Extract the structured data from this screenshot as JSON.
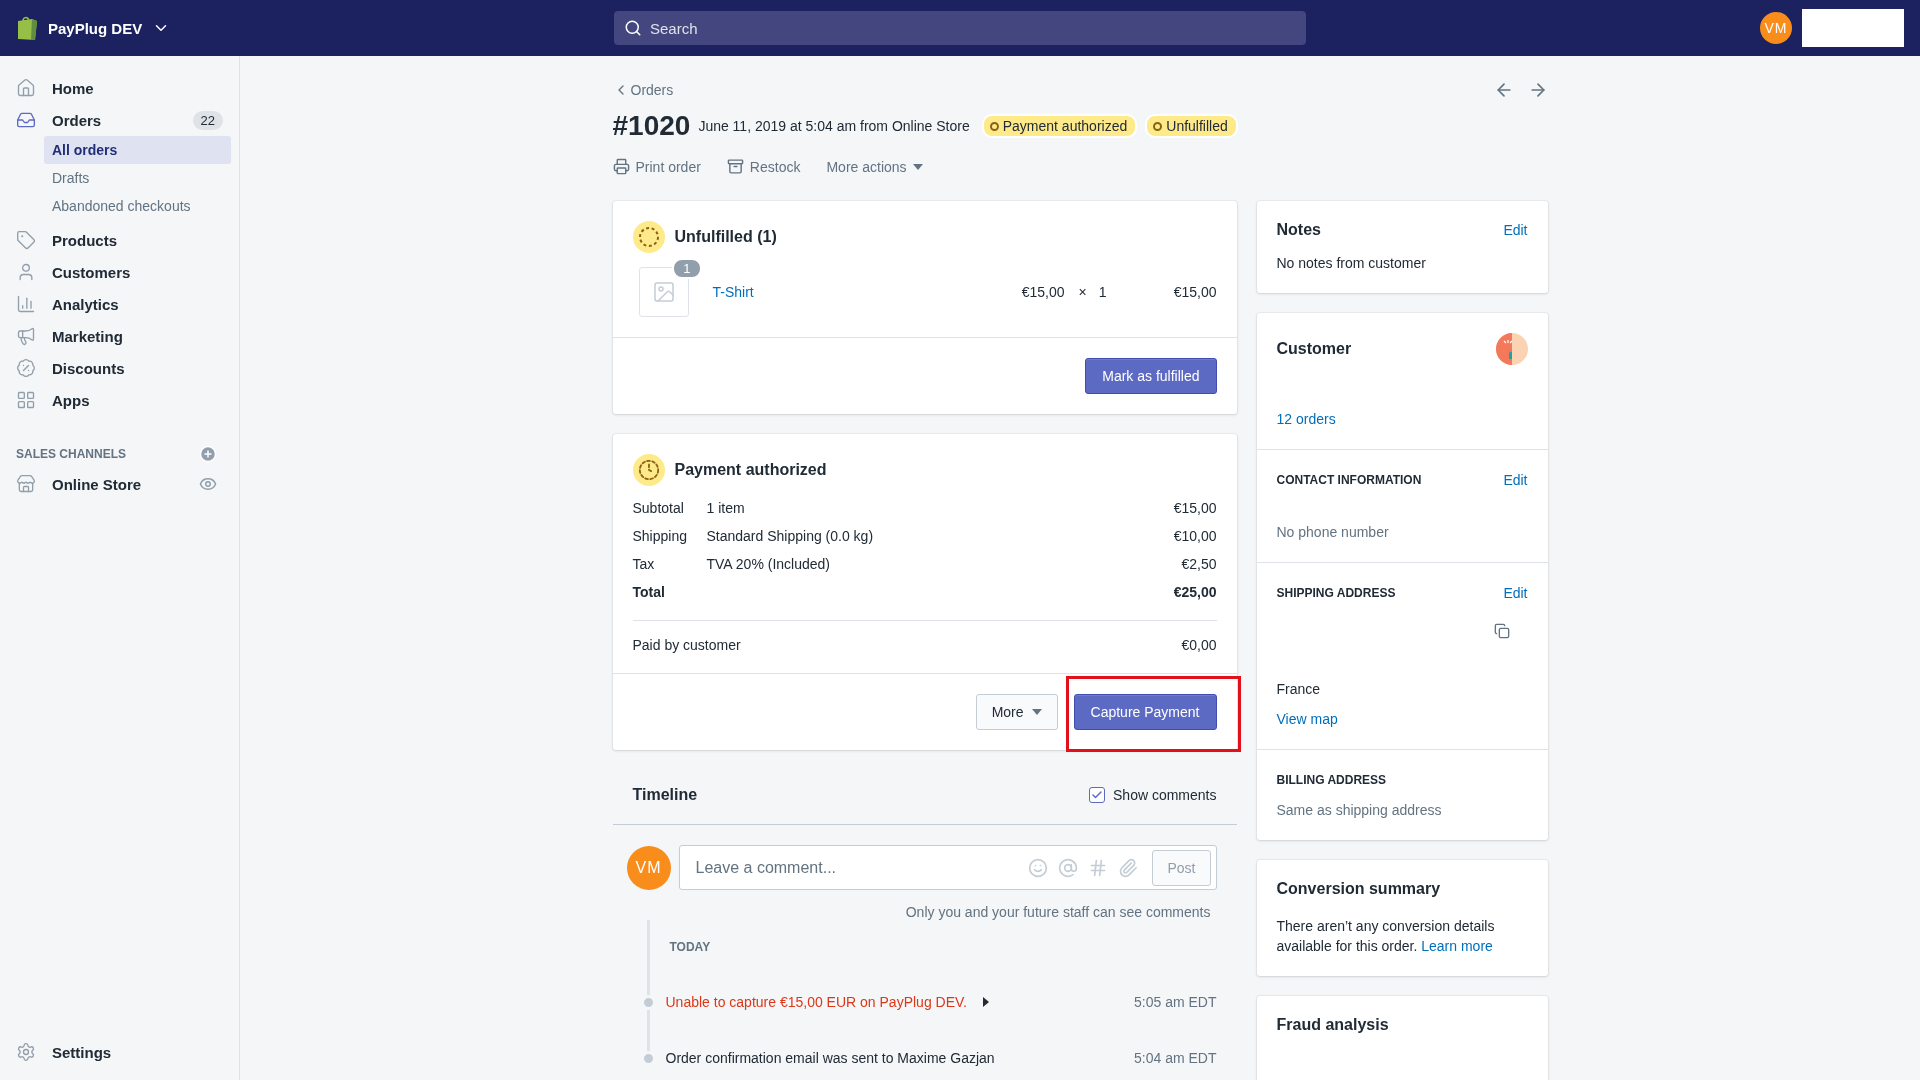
{
  "topbar": {
    "store": "PayPlug DEV",
    "search": {
      "placeholder": "Search"
    },
    "avatar": "VM"
  },
  "sidebar": {
    "items": [
      {
        "label": "Home",
        "selected": false
      },
      {
        "label": "Orders",
        "badge": "22",
        "selected": true,
        "children": [
          {
            "label": "All orders",
            "selected": true
          },
          {
            "label": "Drafts",
            "selected": false
          },
          {
            "label": "Abandoned checkouts",
            "selected": false
          }
        ]
      },
      {
        "label": "Products",
        "selected": false
      },
      {
        "label": "Customers",
        "selected": false
      },
      {
        "label": "Analytics",
        "selected": false
      },
      {
        "label": "Marketing",
        "selected": false
      },
      {
        "label": "Discounts",
        "selected": false
      },
      {
        "label": "Apps",
        "selected": false
      }
    ],
    "channels_heading": "SALES CHANNELS",
    "channels": [
      {
        "label": "Online Store"
      }
    ],
    "settings": "Settings"
  },
  "header": {
    "back": "Orders",
    "number": "#1020",
    "meta": "June 11, 2019 at 5:04 am from Online Store",
    "badges": [
      "Payment authorized",
      "Unfulfilled"
    ],
    "actions": [
      {
        "label": "Print order"
      },
      {
        "label": "Restock"
      },
      {
        "label": "More actions"
      }
    ]
  },
  "fulfillment": {
    "title": "Unfulfilled (1)",
    "item": {
      "quantity_badge": "1",
      "name": "T-Shirt",
      "price": "€15,00",
      "times": "×",
      "qty": "1",
      "total": "€15,00"
    },
    "button": "Mark as fulfilled"
  },
  "payment": {
    "title": "Payment authorized",
    "rows": [
      {
        "label": "Subtotal",
        "detail": "1 item",
        "amount": "€15,00",
        "kind": "normal"
      },
      {
        "label": "Shipping",
        "detail": "Standard Shipping (0.0 kg)",
        "amount": "€10,00",
        "kind": "normal"
      },
      {
        "label": "Tax",
        "detail": "TVA 20% (Included)",
        "amount": "€2,50",
        "kind": "normal"
      },
      {
        "label": "Total",
        "amount": "€25,00",
        "kind": "total"
      }
    ],
    "paid": {
      "label": "Paid by customer",
      "amount": "€0,00"
    },
    "more": "More",
    "primary": "Capture Payment",
    "highlighted": true
  },
  "timeline": {
    "title": "Timeline",
    "show_comments": {
      "label": "Show comments",
      "checked": true
    },
    "comment": {
      "avatar": "VM",
      "placeholder": "Leave a comment...",
      "post": "Post"
    },
    "note": "Only you and your future staff can see comments",
    "day": "TODAY",
    "events": [
      {
        "text": "Unable to capture €15,00 EUR on PayPlug DEV.",
        "time": "5:05 am EDT",
        "kind": "error",
        "expandable": true
      },
      {
        "text": "Order confirmation email was sent to Maxime Gazjan",
        "time": "5:04 am EDT",
        "kind": "normal"
      }
    ]
  },
  "notes": {
    "title": "Notes",
    "action": "Edit",
    "text": "No notes from customer"
  },
  "customer": {
    "title": "Customer",
    "orders_link": "12 orders",
    "sections": [
      {
        "title": "CONTACT INFORMATION",
        "action": "Edit",
        "lines": [
          {
            "text": "No phone number",
            "kind": "muted"
          }
        ]
      },
      {
        "title": "SHIPPING ADDRESS",
        "action": "Edit",
        "copy_icon": true,
        "lines": [
          {
            "text": "France",
            "kind": "plain"
          },
          {
            "text": "View map",
            "kind": "link"
          }
        ]
      },
      {
        "title": "BILLING ADDRESS",
        "lines": [
          {
            "text": "Same as shipping address",
            "kind": "muted"
          }
        ]
      }
    ]
  },
  "conversion": {
    "title": "Conversion summary",
    "text": "There aren’t any conversion details available for this order.",
    "link": "Learn more"
  },
  "fraud": {
    "title": "Fraud analysis"
  }
}
